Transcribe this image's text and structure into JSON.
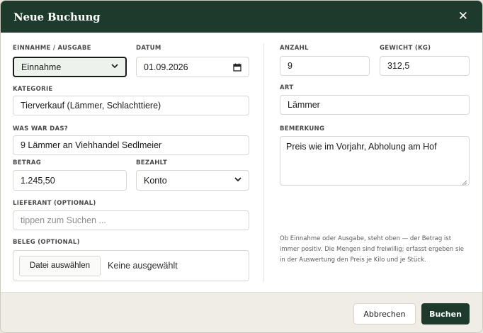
{
  "dialog": {
    "title": "Neue Buchung",
    "close_glyph": "✕"
  },
  "left": {
    "type_label": "EINNAHME / AUSGABE",
    "type_value": "Einnahme",
    "date_label": "DATUM",
    "date_value": "01.09.2026",
    "category_label": "KATEGORIE",
    "category_value": "Tierverkauf (Lämmer, Schlachttiere)",
    "description_label": "WAS WAR DAS?",
    "description_value": "9 Lämmer an Viehhandel Sedlmeier",
    "amount_label": "BETRAG",
    "amount_value": "1.245,50",
    "paid_label": "BEZAHLT",
    "paid_value": "Konto",
    "supplier_label": "LIEFERANT (OPTIONAL)",
    "supplier_placeholder": "tippen zum Suchen ...",
    "receipt_label": "BELEG (OPTIONAL)",
    "receipt_button": "Datei auswählen",
    "receipt_status": "Keine ausgewählt"
  },
  "right": {
    "count_label": "ANZAHL",
    "count_value": "9",
    "weight_label": "GEWICHT (KG)",
    "weight_value": "312,5",
    "kind_label": "ART",
    "kind_value": "Lämmer",
    "note_label": "BEMERKUNG",
    "note_value": "Preis wie im Vorjahr, Abholung am Hof",
    "hint": "Ob Einnahme oder Ausgabe, steht oben — der Betrag ist immer positiv. Die Mengen sind freiwillig; erfasst ergeben sie in der Auswertung den Preis je Kilo und je Stück."
  },
  "footer": {
    "cancel_label": "Abbrechen",
    "submit_label": "Buchen"
  },
  "colors": {
    "header_bg": "#1d3a2c",
    "primary_button": "#1d3a2c",
    "footer_bg": "#f0ede6"
  },
  "icons": {
    "close": "close-icon",
    "select": "chevron-down-icon",
    "date": "calendar-icon",
    "resize": "resize-grip-icon"
  }
}
